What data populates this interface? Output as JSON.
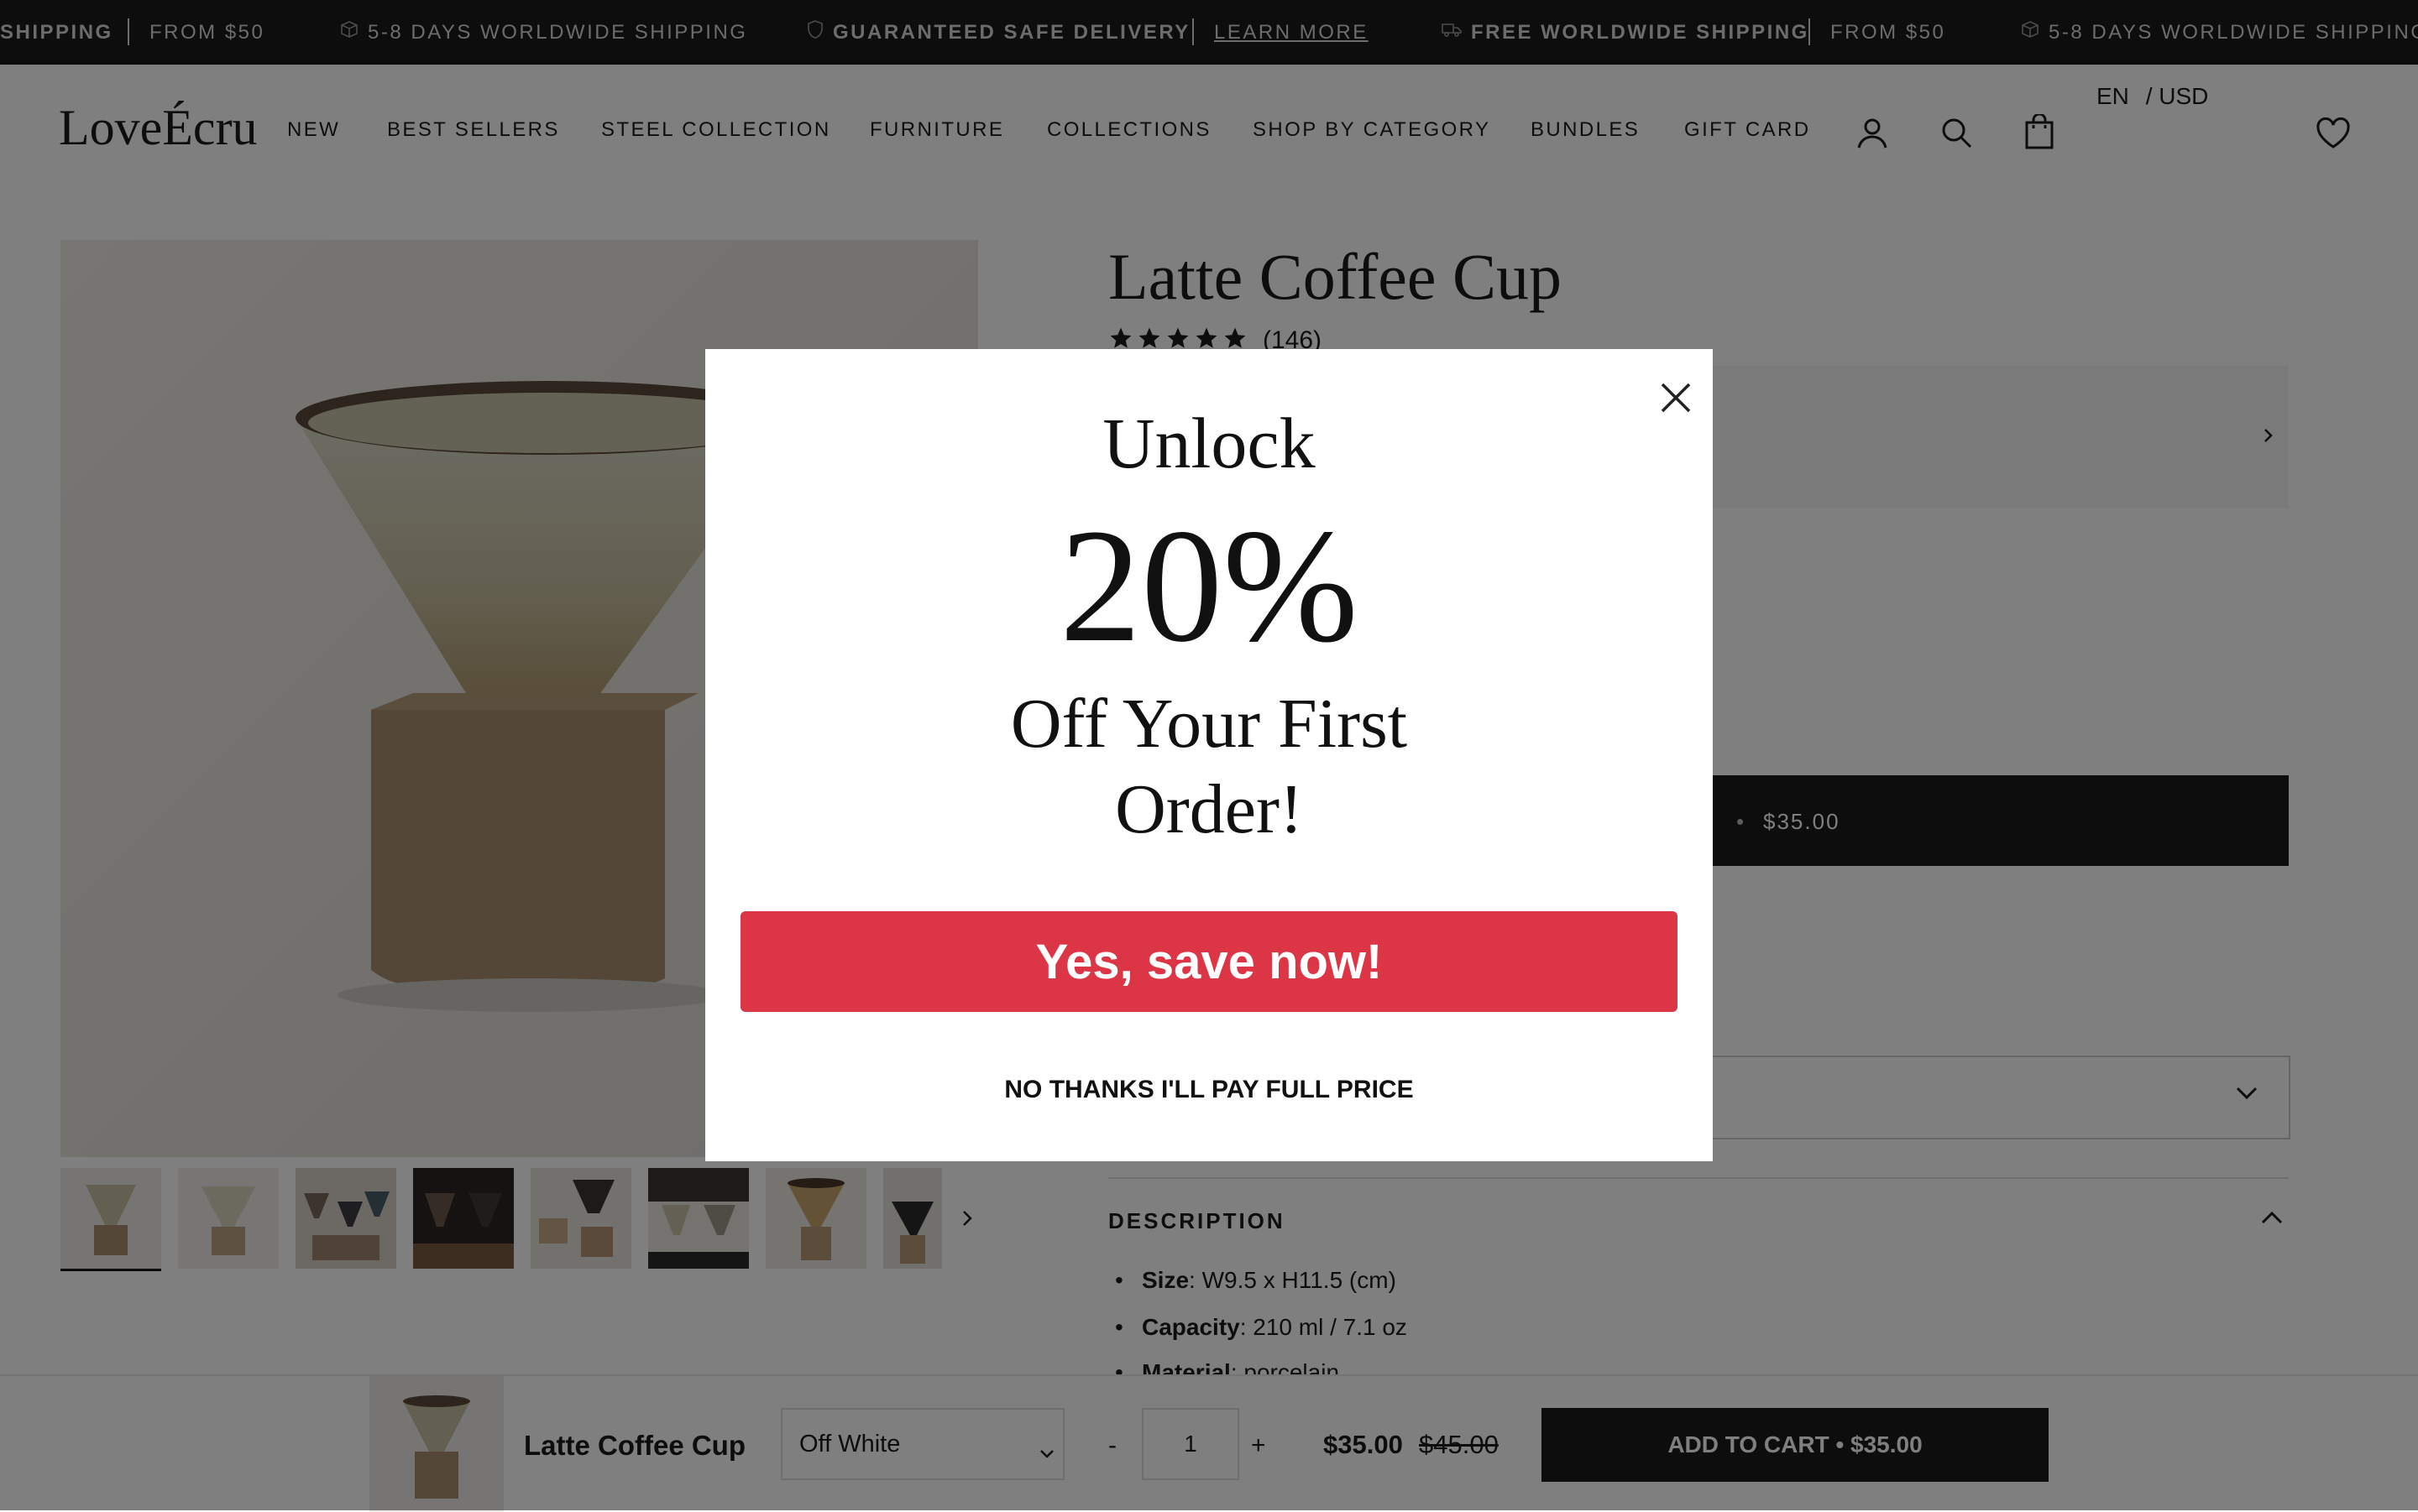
{
  "announcement": {
    "items": [
      {
        "text": "SHIPPING",
        "bold": true
      },
      {
        "text": "FROM $50"
      },
      {
        "text": "5-8 DAYS WORLDWIDE SHIPPING"
      },
      {
        "text": "GUARANTEED SAFE DELIVERY",
        "bold": true
      },
      {
        "text": "LEARN MORE"
      },
      {
        "text": "FREE WORLDWIDE SHIPPING",
        "bold": true
      },
      {
        "text": "FROM $50"
      },
      {
        "text": "5-8 DAYS WORLDWIDE SHIPPING"
      }
    ]
  },
  "header": {
    "logo": "LoveÉcru",
    "nav": [
      "NEW",
      "BEST SELLERS",
      "STEEL COLLECTION",
      "FURNITURE",
      "COLLECTIONS",
      "SHOP BY CATEGORY",
      "BUNDLES",
      "GIFT CARD"
    ],
    "language": "EN",
    "currency": "/ USD"
  },
  "product": {
    "title": "Latte Coffee Cup",
    "rating_stars": 5,
    "review_count": "(146)",
    "add_to_cart_price": "$35.00",
    "description_heading": "DESCRIPTION",
    "specs": [
      {
        "key": "Size",
        "value": ": W9.5 x H11.5 (cm)"
      },
      {
        "key": "Capacity",
        "value": ": 210 ml / 7.1 oz"
      },
      {
        "key": "Material",
        "value": ": porcelain"
      }
    ]
  },
  "sticky": {
    "title": "Latte Coffee Cup",
    "variant": "Off White",
    "qty": "1",
    "minus": "-",
    "plus": "+",
    "price": "$35.00",
    "compare_price": "$45.00",
    "add_to_cart": "ADD TO CART • $35.00"
  },
  "popup": {
    "heading": "Unlock",
    "percent": "20%",
    "subheading": "Off Your First Order!",
    "cta": "Yes, save now!",
    "decline": "NO THANKS I'LL PAY FULL PRICE"
  },
  "colors": {
    "cta_red": "#dc3545",
    "dark": "#1a1a1a"
  },
  "icons": [
    "truck-icon",
    "shield-icon",
    "box-icon",
    "account-icon",
    "search-icon",
    "cart-icon",
    "heart-icon",
    "close-icon",
    "chevron-right-icon",
    "chevron-down-icon",
    "chevron-up-icon",
    "star-icon"
  ]
}
